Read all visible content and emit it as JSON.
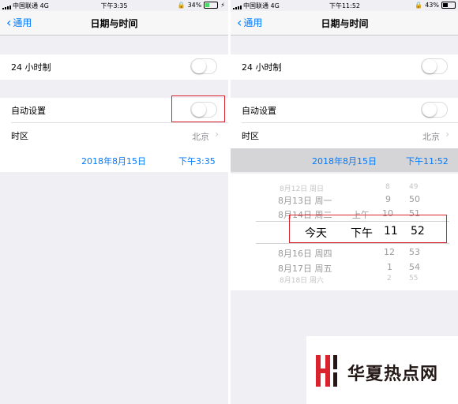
{
  "left": {
    "status": {
      "carrier": "中国联通  4G",
      "time": "下午3:35",
      "battery": "34%"
    },
    "nav": {
      "back": "通用",
      "title": "日期与时间"
    },
    "hour24_label": "24 小时制",
    "auto_label": "自动设置",
    "tz_label": "时区",
    "tz_value": "北京",
    "date": "2018年8月15日",
    "time": "下午3:35"
  },
  "right": {
    "status": {
      "carrier": "中国联通  4G",
      "time": "下午11:52",
      "battery": "43%"
    },
    "nav": {
      "back": "通用",
      "title": "日期与时间"
    },
    "hour24_label": "24 小时制",
    "auto_label": "自动设置",
    "tz_label": "时区",
    "tz_value": "北京",
    "date": "2018年8月15日",
    "time": "下午11:52",
    "picker": {
      "r1": {
        "d": "8月12日 周日",
        "h": "8",
        "m": "49"
      },
      "r2": {
        "d": "8月13日 周一",
        "h": "9",
        "m": "50"
      },
      "r3": {
        "d": "8月14日 周二",
        "ap": "上午",
        "h": "10",
        "m": "51"
      },
      "sel": {
        "d": "今天",
        "ap": "下午",
        "h": "11",
        "m": "52"
      },
      "r5": {
        "d": "8月16日 周四",
        "h": "12",
        "m": "53"
      },
      "r6": {
        "d": "8月17日 周五",
        "h": "1",
        "m": "54"
      },
      "r7": {
        "d": "8月18日 周六",
        "h": "2",
        "m": "55"
      }
    }
  },
  "watermark": {
    "text": "华夏热点网"
  },
  "colors": {
    "accent": "#007aff",
    "highlight": "#d9232e",
    "logo": "#d9232e"
  }
}
